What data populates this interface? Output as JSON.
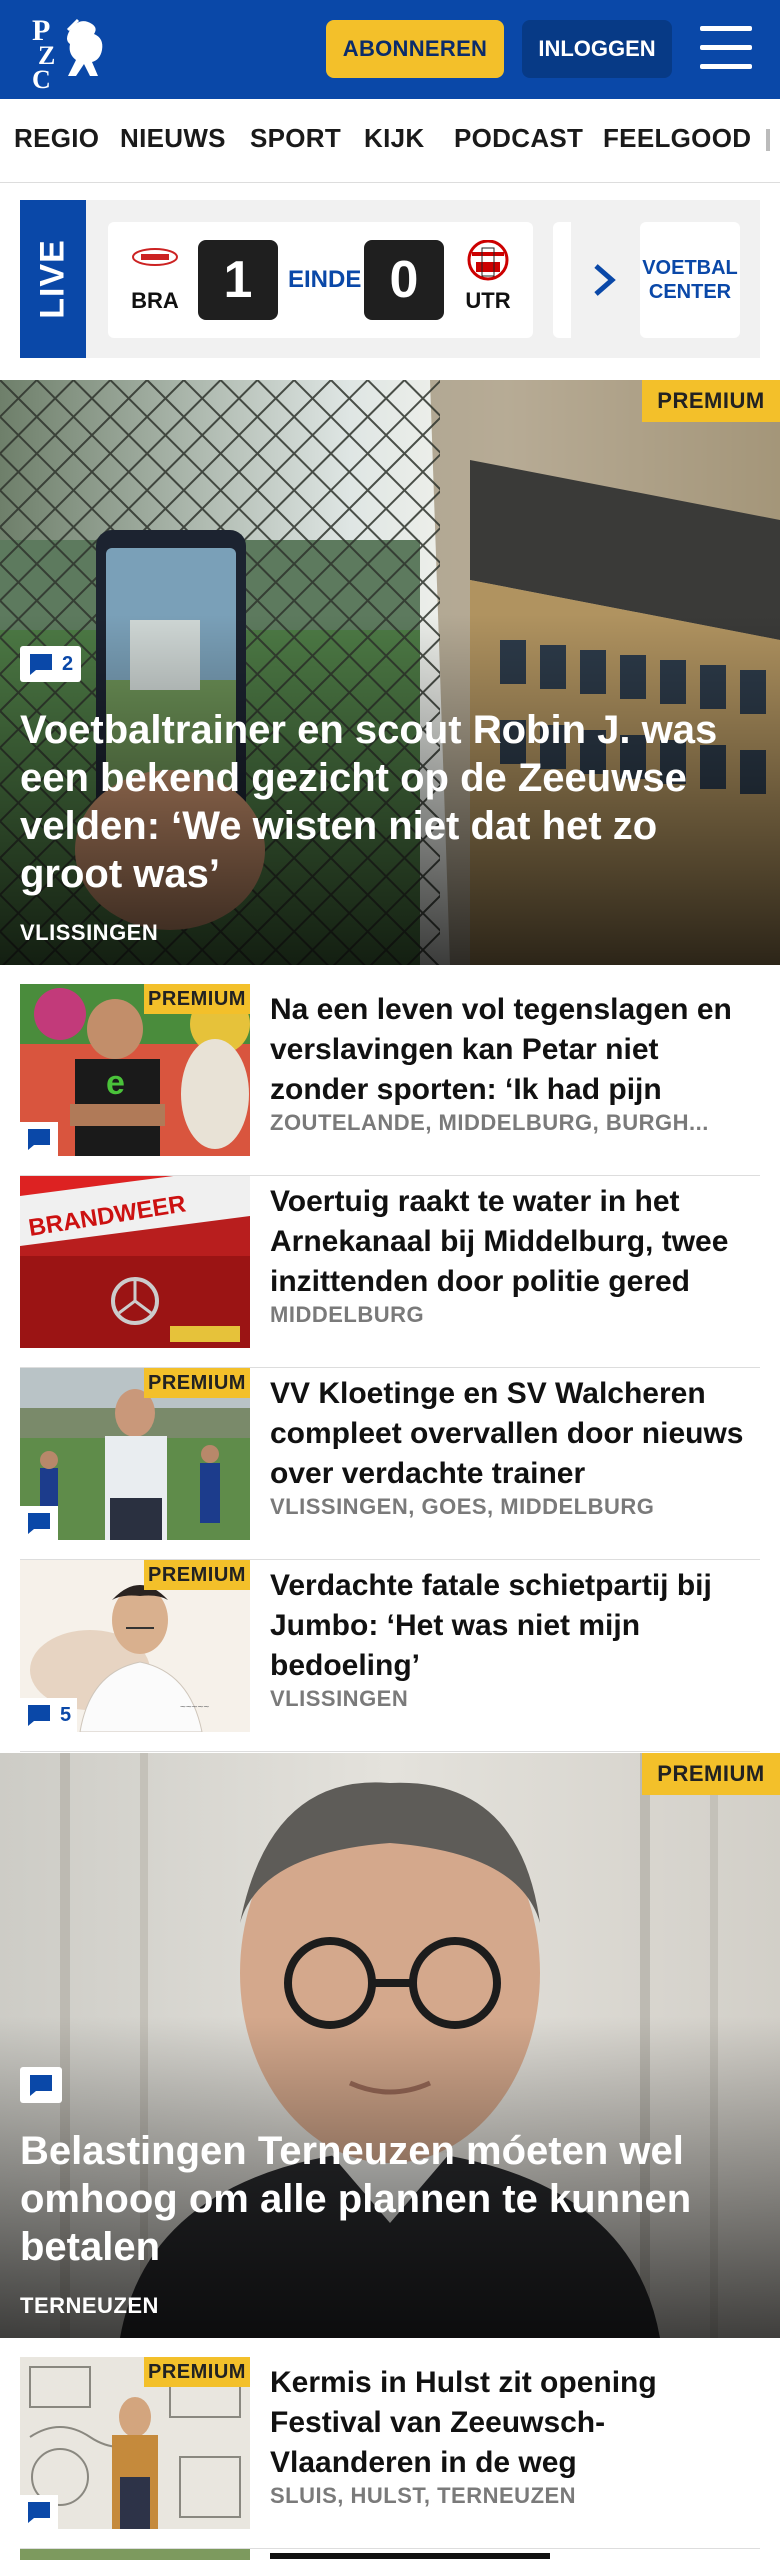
{
  "header": {
    "logo_text": "PZC",
    "subscribe_label": "ABONNEREN",
    "login_label": "INLOGGEN",
    "menu_icon": "hamburger-icon",
    "brand_color": "#0a48a8",
    "accent_color": "#f3c02a"
  },
  "nav": {
    "items": [
      "REGIO",
      "NIEUWS",
      "SPORT",
      "KIJK",
      "PODCAST",
      "FEELGOOD"
    ]
  },
  "live": {
    "label": "LIVE",
    "home_team": "BRA",
    "home_score": "1",
    "status": "EINDE",
    "away_score": "0",
    "away_team": "UTR",
    "center_label_1": "VOETBAL",
    "center_label_2": "CENTER"
  },
  "premium_label": "PREMIUM",
  "hero1": {
    "comments": "2",
    "title": "Voetbaltrainer en scout Robin J. was een bekend gezicht op de Zeeuwse velden: ‘We wisten niet dat het zo groot was’",
    "location": "VLISSINGEN"
  },
  "articles": [
    {
      "title": "Na een leven vol tegenslagen en verslavingen kan Petar niet zonder sporten: ‘Ik had pijn waa...",
      "location": "ZOUTELANDE, MIDDELBURG, BURGH...",
      "premium": true,
      "comments": ""
    },
    {
      "title": "Voertuig raakt te water in het Arnekanaal bij Middelburg, twee inzittenden door politie gered",
      "location": "MIDDELBURG",
      "premium": false,
      "thumb_text": "BRANDWEER"
    },
    {
      "title": "VV Kloetinge en SV Walcheren compleet overvallen door nieuws over verdachte trainer",
      "location": "VLISSINGEN, GOES, MIDDELBURG",
      "premium": true,
      "comments": ""
    },
    {
      "title": "Verdachte fatale schietpartij bij Jumbo: ‘Het was niet mijn bedoeling’",
      "location": "VLISSINGEN",
      "premium": true,
      "comments": "5"
    }
  ],
  "hero2": {
    "comments": "",
    "title": "Belastingen Terneuzen móeten wel omhoog om alle plannen te kunnen betalen",
    "location": "TERNEUZEN"
  },
  "articles2": [
    {
      "title": "Kermis in Hulst zit opening Festival van Zeeuwsch-Vlaanderen in de weg",
      "location": "SLUIS, HULST, TERNEUZEN",
      "premium": true,
      "comments": ""
    }
  ]
}
